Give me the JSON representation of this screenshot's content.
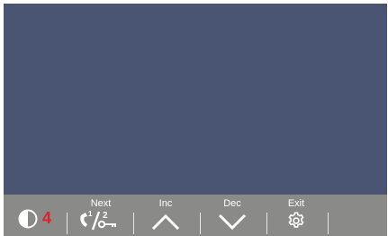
{
  "toolbar": {
    "contrast": {
      "icon": "contrast-icon",
      "value": "4",
      "value_color": "#e0202a"
    },
    "next": {
      "label": "Next",
      "icon": "call-transfer-icon",
      "icon_digit_1": "1",
      "icon_digit_2": "2"
    },
    "inc": {
      "label": "Inc",
      "icon": "chevron-up-icon"
    },
    "dec": {
      "label": "Dec",
      "icon": "chevron-down-icon"
    },
    "exit": {
      "label": "Exit",
      "icon": "gear-icon"
    }
  },
  "colors": {
    "screen": "#4a5573",
    "toolbar": "#8a8a88",
    "icon": "#ffffff"
  }
}
